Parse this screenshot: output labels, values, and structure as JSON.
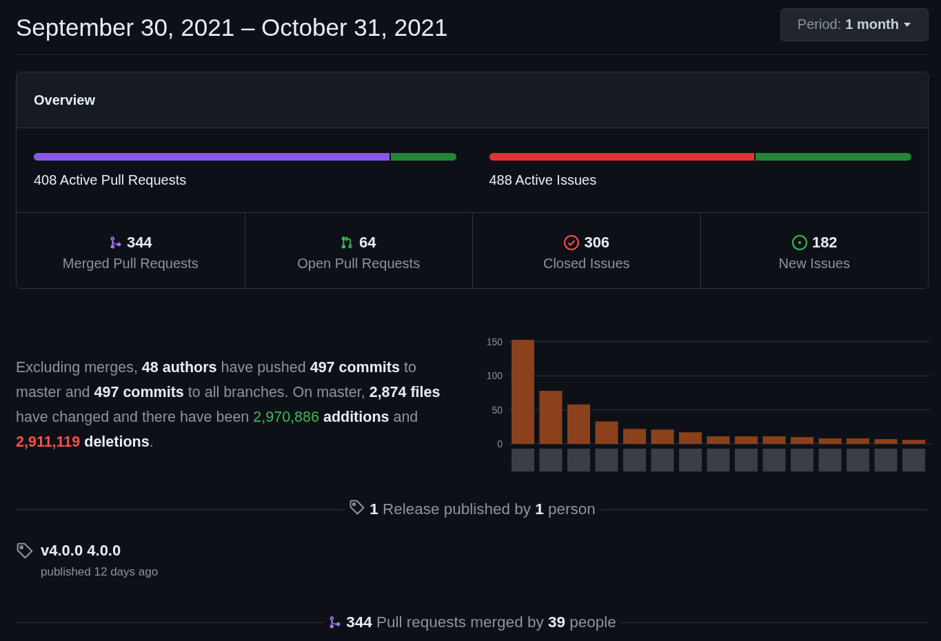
{
  "header": {
    "title": "September 30, 2021 – October 31, 2021",
    "period_button": {
      "label": "Period:",
      "value": "1 month"
    }
  },
  "overview": {
    "title": "Overview",
    "bars": [
      {
        "label": "408 Active Pull Requests",
        "level": 0.843,
        "kind": "pulls"
      },
      {
        "label": "488 Active Issues",
        "level": 0.627,
        "kind": "issues"
      }
    ],
    "stats": [
      {
        "kind": "merged",
        "count": "344",
        "label": "Merged Pull Requests"
      },
      {
        "kind": "open-pr",
        "count": "64",
        "label": "Open Pull Requests"
      },
      {
        "kind": "closed-issue",
        "count": "306",
        "label": "Closed Issues"
      },
      {
        "kind": "new-issue",
        "count": "182",
        "label": "New Issues"
      }
    ]
  },
  "summary": {
    "segments": [
      {
        "kind": "text",
        "text": "Excluding merges, "
      },
      {
        "kind": "bold",
        "text": "48 authors"
      },
      {
        "kind": "text",
        "text": " have pushed "
      },
      {
        "kind": "bold",
        "text": "497 commits"
      },
      {
        "kind": "text",
        "text": " to master and "
      },
      {
        "kind": "bold",
        "text": "497 commits"
      },
      {
        "kind": "text",
        "text": " to all branches. On master, "
      },
      {
        "kind": "bold",
        "text": "2,874 files"
      },
      {
        "kind": "text",
        "text": " have changed and there have been "
      },
      {
        "kind": "added",
        "text": "2,970,886"
      },
      {
        "kind": "bold",
        "text": " additions"
      },
      {
        "kind": "text",
        "text": " and "
      },
      {
        "kind": "removed",
        "text": "2,911,119"
      },
      {
        "kind": "bold",
        "text": " deletions"
      },
      {
        "kind": "text",
        "text": "."
      }
    ],
    "chart_data": {
      "type": "bar",
      "values": [
        153,
        78,
        58,
        33,
        22,
        21,
        17,
        11,
        11,
        11,
        10,
        8,
        8,
        7,
        6
      ],
      "ylim": [
        0,
        155
      ],
      "yticks": [
        0,
        50,
        100,
        150
      ],
      "grid": true
    }
  },
  "releases": {
    "heading": "**1** Release published by **1** person",
    "items": [
      {
        "name": "v4.0.0 4.0.0",
        "meta": "published 12 days ago"
      }
    ]
  },
  "merged_heading": "**344** Pull requests merged by **39** people"
}
